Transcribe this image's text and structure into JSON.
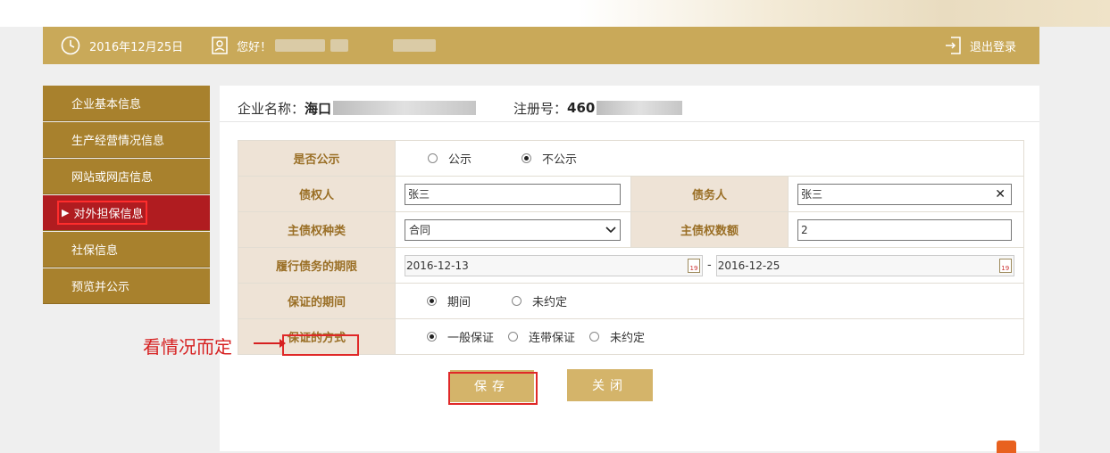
{
  "header": {
    "date": "2016年12月25日",
    "greeting": "您好！",
    "logout": "退出登录"
  },
  "sidebar": {
    "items": [
      {
        "label": "企业基本信息"
      },
      {
        "label": "生产经营情况信息"
      },
      {
        "label": "网站或网店信息"
      },
      {
        "label": "对外担保信息",
        "active": true
      },
      {
        "label": "社保信息"
      },
      {
        "label": "预览并公示"
      }
    ]
  },
  "company": {
    "name_label": "企业名称：",
    "name_value": "海口",
    "reg_label": "注册号：",
    "reg_value": "460"
  },
  "form": {
    "publish": {
      "label": "是否公示",
      "options": [
        "公示",
        "不公示"
      ],
      "selected": "不公示"
    },
    "creditor": {
      "label": "债权人",
      "value": "张三"
    },
    "debtor": {
      "label": "债务人",
      "value": "张三"
    },
    "claim_type": {
      "label": "主债权种类",
      "value": "合同"
    },
    "claim_amount": {
      "label": "主债权数额",
      "value": "2"
    },
    "term": {
      "label": "履行债务的期限",
      "start": "2016-12-13",
      "sep": "-",
      "end": "2016-12-25"
    },
    "guarantee_period": {
      "label": "保证的期间",
      "options": [
        "期间",
        "未约定"
      ],
      "selected": "期间"
    },
    "guarantee_method": {
      "label": "保证的方式",
      "options": [
        "一般保证",
        "连带保证",
        "未约定"
      ],
      "selected": "一般保证"
    }
  },
  "buttons": {
    "save": "保存",
    "close": "关闭"
  },
  "annotation": {
    "text": "看情况而定"
  },
  "colors": {
    "header_gold": "#c9a959",
    "sidebar_brown": "#a8812d",
    "active_red": "#b01c20",
    "label_text": "#9a6f26",
    "annotation_red": "#d62020"
  }
}
